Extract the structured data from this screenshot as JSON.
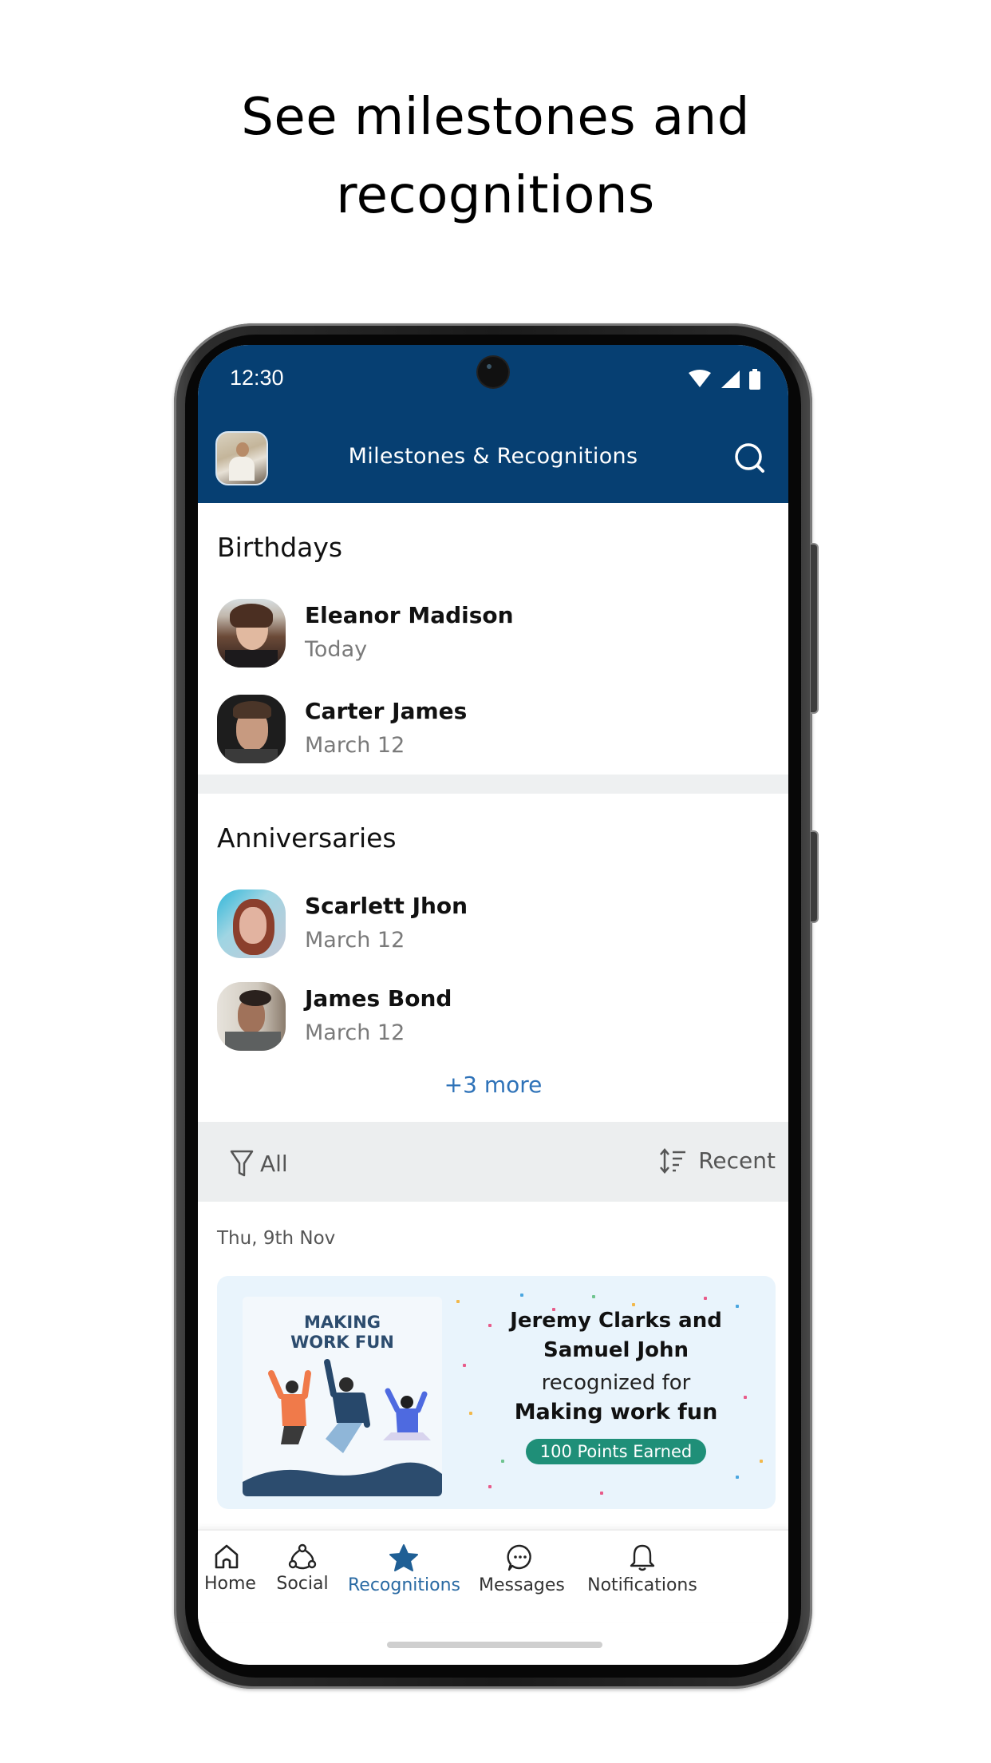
{
  "headline": {
    "line1": "See milestones and",
    "line2": "recognitions"
  },
  "status_bar": {
    "time": "12:30",
    "icons": [
      "wifi-icon",
      "signal-icon",
      "battery-icon"
    ]
  },
  "app_bar": {
    "title": "Milestones & Recognitions",
    "avatar": "profile-avatar",
    "search_icon": "search-icon"
  },
  "birthdays": {
    "title": "Birthdays",
    "people": [
      {
        "name": "Eleanor Madison",
        "date": "Today"
      },
      {
        "name": "Carter James",
        "date": "March 12"
      }
    ]
  },
  "anniversaries": {
    "title": "Anniversaries",
    "people": [
      {
        "name": "Scarlett Jhon",
        "date": "March 12"
      },
      {
        "name": "James Bond",
        "date": "March 12"
      }
    ],
    "more_link": "+3 more"
  },
  "filter_bar": {
    "filter_label": "All",
    "sort_label": "Recent"
  },
  "feed": {
    "date": "Thu, 9th Nov",
    "card": {
      "art_title_line1": "MAKING",
      "art_title_line2": "WORK FUN",
      "names": "Jeremy Clarks and Samuel John",
      "recognized_text": "recognized for",
      "reason": "Making work fun",
      "points_badge": "100 Points Earned"
    }
  },
  "bottom_nav": {
    "items": [
      {
        "label": "Home",
        "icon": "home-icon",
        "active": false
      },
      {
        "label": "Social",
        "icon": "social-icon",
        "active": false
      },
      {
        "label": "Recognitions",
        "icon": "star-icon",
        "active": true
      },
      {
        "label": "Messages",
        "icon": "message-icon",
        "active": false
      },
      {
        "label": "Notifications",
        "icon": "bell-icon",
        "active": false
      }
    ]
  },
  "colors": {
    "header": "#063f72",
    "accent": "#2a6aa3",
    "link": "#2e72b8",
    "badge": "#1f8f78",
    "card_bg": "#e9f4fc",
    "filter_bg": "#eceeef"
  }
}
